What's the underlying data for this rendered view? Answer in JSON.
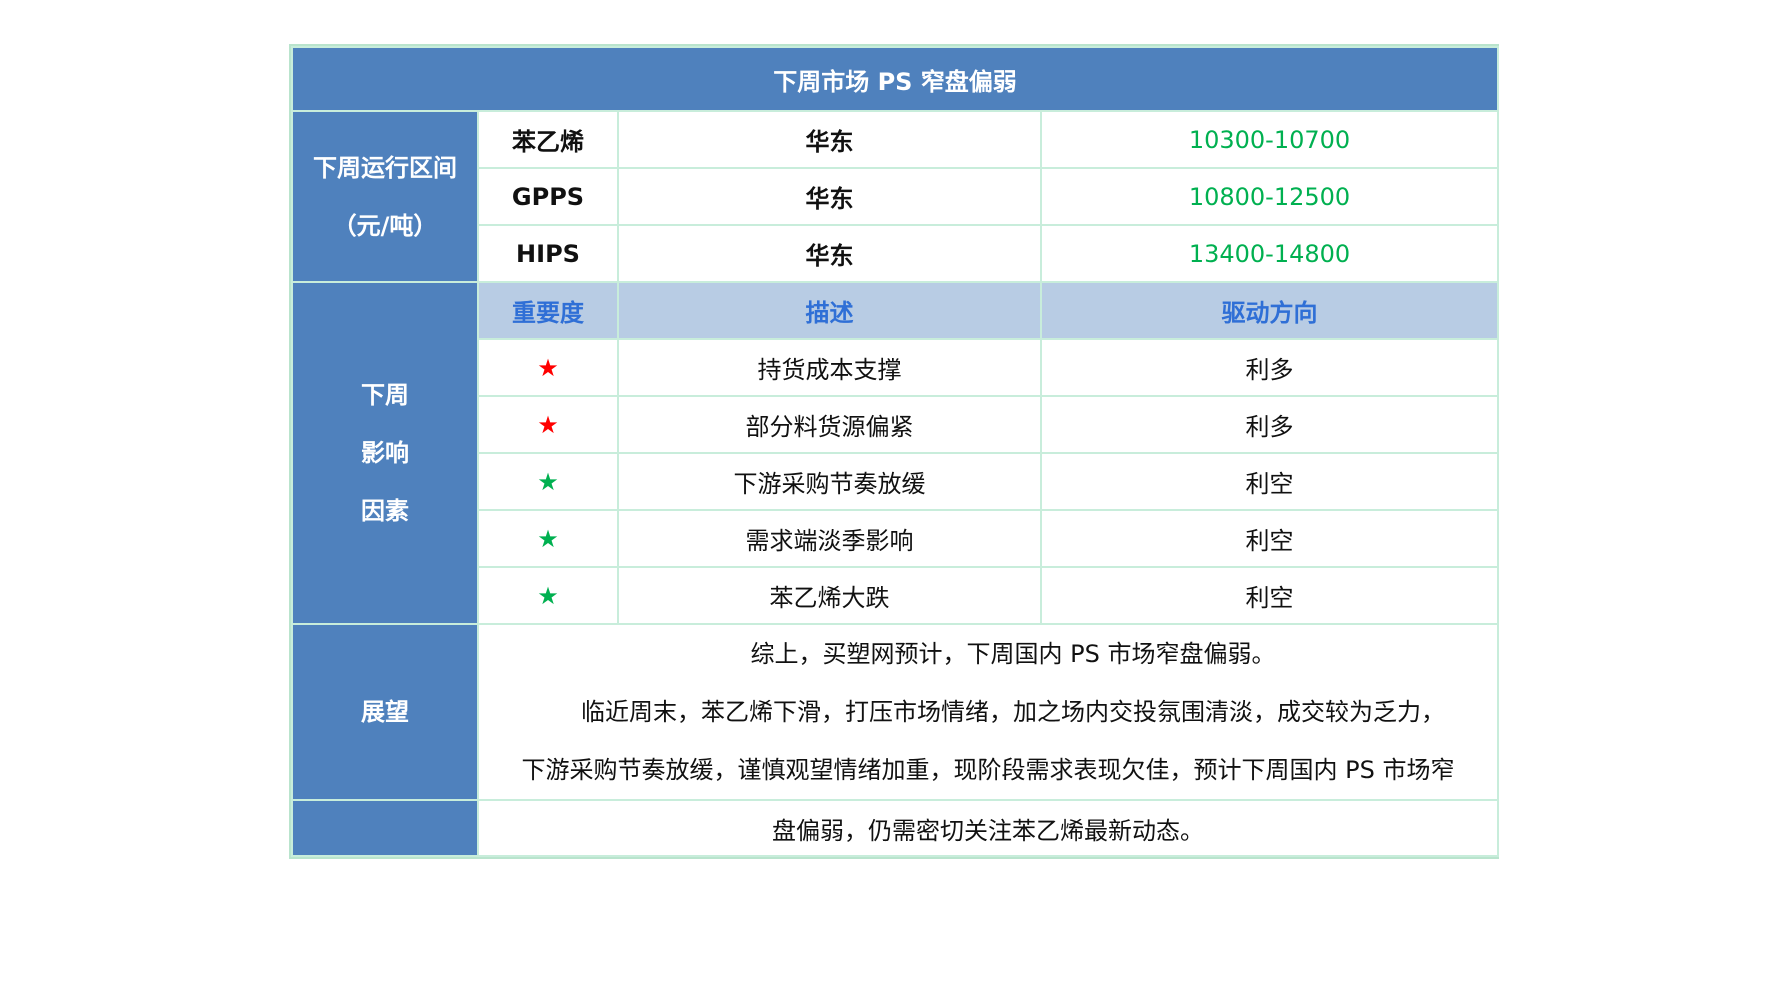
{
  "title": "下周市场 PS 窄盘偏弱",
  "range_section": {
    "label_line1": "下周运行区间",
    "label_line2": "（元/吨）",
    "rows": [
      {
        "product": "苯乙烯",
        "region": "华东",
        "range": "10300-10700"
      },
      {
        "product": "GPPS",
        "region": "华东",
        "range": "10800-12500"
      },
      {
        "product": "HIPS",
        "region": "华东",
        "range": "13400-14800"
      }
    ]
  },
  "factor_section": {
    "label_lines": [
      "下周",
      "影响",
      "因素"
    ],
    "headers": {
      "importance": "重要度",
      "description": "描述",
      "direction": "驱动方向"
    },
    "rows": [
      {
        "star": "★",
        "star_color": "#ff0000",
        "description": "持货成本支撑",
        "direction": "利多"
      },
      {
        "star": "★",
        "star_color": "#ff0000",
        "description": "部分料货源偏紧",
        "direction": "利多"
      },
      {
        "star": "★",
        "star_color": "#00b050",
        "description": "下游采购节奏放缓",
        "direction": "利空"
      },
      {
        "star": "★",
        "star_color": "#00b050",
        "description": "需求端淡季影响",
        "direction": "利空"
      },
      {
        "star": "★",
        "star_color": "#00b050",
        "description": "苯乙烯大跌",
        "direction": "利空"
      }
    ]
  },
  "outlook_section": {
    "label": "展望",
    "lines": [
      "综上，买塑网预计，下周国内 PS 市场窄盘偏弱。",
      "临近周末，苯乙烯下滑，打压市场情绪，加之场内交投氛围清淡，成交较为乏力，",
      "下游采购节奏放缓，谨慎观望情绪加重，现阶段需求表现欠佳，预计下周国内 PS 市场窄",
      "盘偏弱，仍需密切关注苯乙烯最新动态。"
    ]
  },
  "colors": {
    "header_blue": "#4f81bd",
    "subheader_blue": "#b8cce4",
    "subheader_text": "#2f6fd6",
    "range_green": "#00b050",
    "grid": "#c8eddb"
  }
}
